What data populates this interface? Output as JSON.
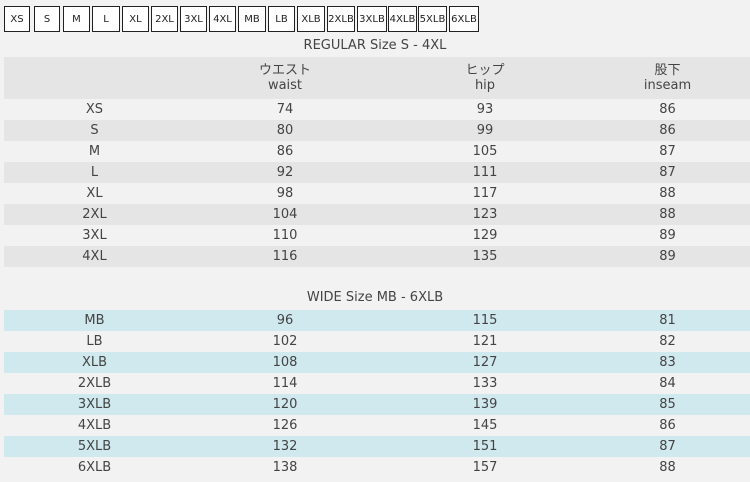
{
  "tabs": [
    "XS",
    "S",
    "M",
    "L",
    "XL",
    "2XL",
    "3XL",
    "4XL",
    "MB",
    "LB",
    "XLB",
    "2XLB",
    "3XLB",
    "4XLB",
    "5XLB",
    "6XLB"
  ],
  "regular": {
    "title": "REGULAR Size  S - 4XL",
    "headers": [
      {
        "jp": "",
        "en": ""
      },
      {
        "jp": "ウエスト",
        "en": "waist"
      },
      {
        "jp": "ヒップ",
        "en": "hip"
      },
      {
        "jp": "股下",
        "en": "inseam"
      }
    ],
    "rows": [
      [
        "XS",
        "74",
        "93",
        "86"
      ],
      [
        "S",
        "80",
        "99",
        "86"
      ],
      [
        "M",
        "86",
        "105",
        "87"
      ],
      [
        "L",
        "92",
        "111",
        "87"
      ],
      [
        "XL",
        "98",
        "117",
        "88"
      ],
      [
        "2XL",
        "104",
        "123",
        "88"
      ],
      [
        "3XL",
        "110",
        "129",
        "89"
      ],
      [
        "4XL",
        "116",
        "135",
        "89"
      ]
    ]
  },
  "wide": {
    "title": "WIDE Size  MB - 6XLB",
    "rows": [
      [
        "MB",
        "96",
        "115",
        "81"
      ],
      [
        "LB",
        "102",
        "121",
        "82"
      ],
      [
        "XLB",
        "108",
        "127",
        "83"
      ],
      [
        "2XLB",
        "114",
        "133",
        "84"
      ],
      [
        "3XLB",
        "120",
        "139",
        "85"
      ],
      [
        "4XLB",
        "126",
        "145",
        "86"
      ],
      [
        "5XLB",
        "132",
        "151",
        "87"
      ],
      [
        "6XLB",
        "138",
        "157",
        "88"
      ]
    ]
  }
}
